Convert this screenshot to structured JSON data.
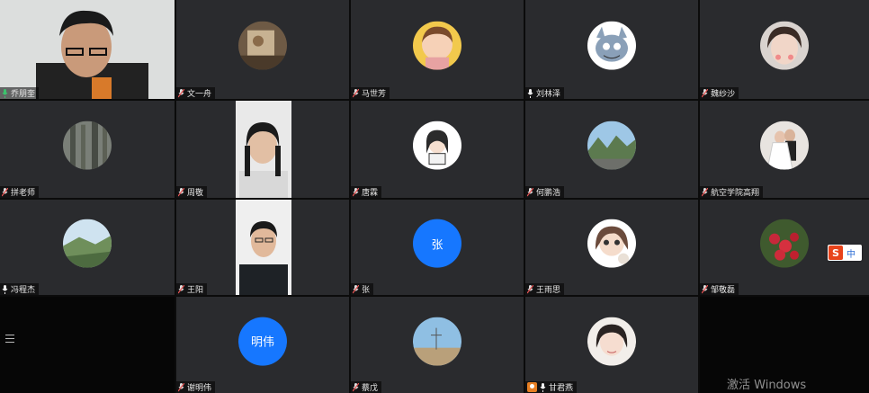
{
  "participants": [
    {
      "name": "乔朋奎",
      "mic": "green"
    },
    {
      "name": "文一舟",
      "mic": "muted"
    },
    {
      "name": "马世芳",
      "mic": "muted"
    },
    {
      "name": "刘林泽",
      "mic": "on"
    },
    {
      "name": "魏纱沙",
      "mic": "muted"
    },
    {
      "name": "拼老师",
      "mic": "muted"
    },
    {
      "name": "周敬",
      "mic": "muted"
    },
    {
      "name": "唐霖",
      "mic": "muted"
    },
    {
      "name": "何鹏浩",
      "mic": "muted"
    },
    {
      "name": "航空学院高翔",
      "mic": "muted"
    },
    {
      "name": "冯程杰",
      "mic": "on"
    },
    {
      "name": "王阳",
      "mic": "muted"
    },
    {
      "name": "张",
      "mic": "muted",
      "avatar_text": "张"
    },
    {
      "name": "王雨思",
      "mic": "muted"
    },
    {
      "name": "邹敬磊",
      "mic": "muted"
    },
    {
      "name": "谢明伟",
      "mic": "muted",
      "avatar_text": "明伟"
    },
    {
      "name": "蔡戊",
      "mic": "muted"
    },
    {
      "name": "甘君燕",
      "mic": "on",
      "host": true
    }
  ],
  "ime": {
    "logo": "S",
    "mode": "中"
  },
  "watermark": "激活 Windows",
  "colors": {
    "tile": "#2a2b2e",
    "avatar_blue": "#1677ff",
    "mic_green": "#3cc26d",
    "mic_muted": "#e35353"
  }
}
